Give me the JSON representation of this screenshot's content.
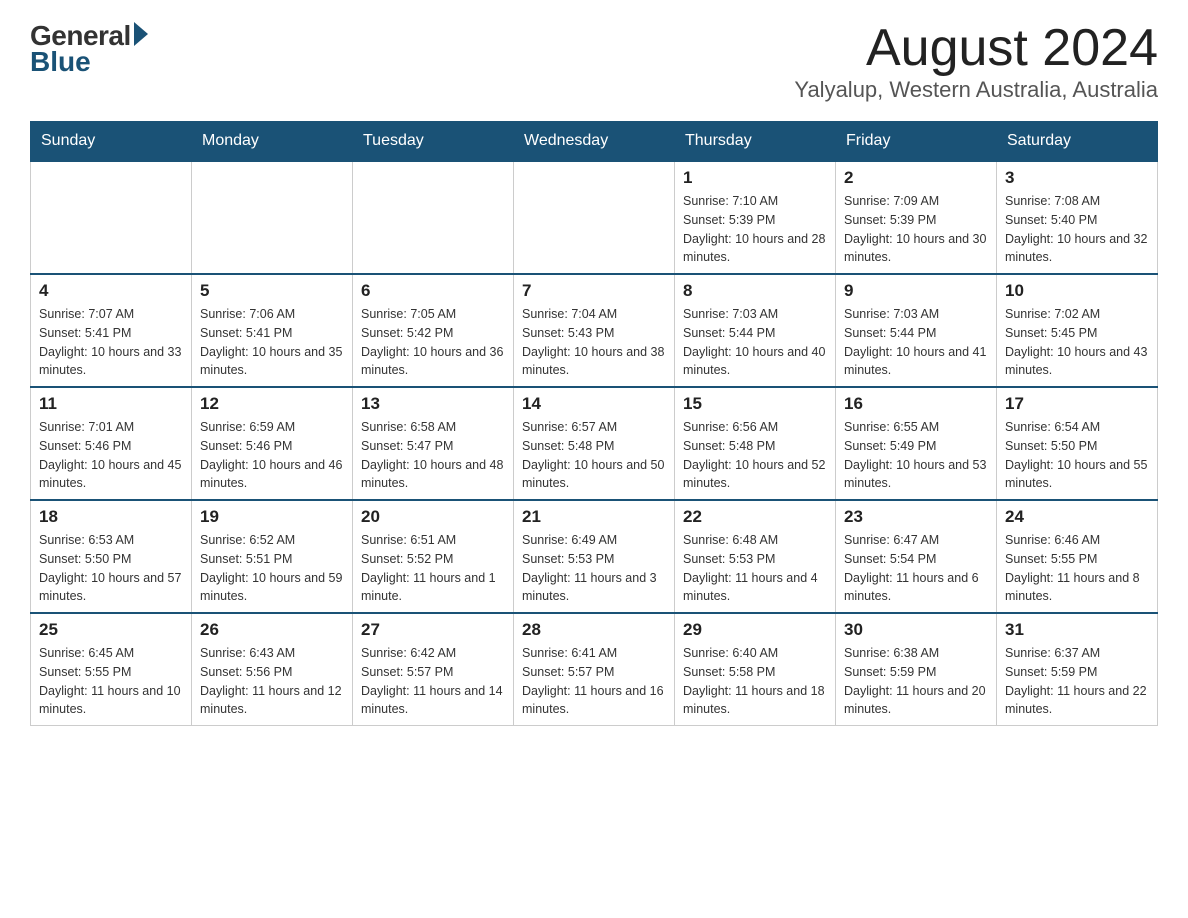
{
  "header": {
    "logo_general": "General",
    "logo_blue": "Blue",
    "month_title": "August 2024",
    "location": "Yalyalup, Western Australia, Australia"
  },
  "calendar": {
    "days_of_week": [
      "Sunday",
      "Monday",
      "Tuesday",
      "Wednesday",
      "Thursday",
      "Friday",
      "Saturday"
    ],
    "weeks": [
      [
        {
          "day": "",
          "info": ""
        },
        {
          "day": "",
          "info": ""
        },
        {
          "day": "",
          "info": ""
        },
        {
          "day": "",
          "info": ""
        },
        {
          "day": "1",
          "info": "Sunrise: 7:10 AM\nSunset: 5:39 PM\nDaylight: 10 hours and 28 minutes."
        },
        {
          "day": "2",
          "info": "Sunrise: 7:09 AM\nSunset: 5:39 PM\nDaylight: 10 hours and 30 minutes."
        },
        {
          "day": "3",
          "info": "Sunrise: 7:08 AM\nSunset: 5:40 PM\nDaylight: 10 hours and 32 minutes."
        }
      ],
      [
        {
          "day": "4",
          "info": "Sunrise: 7:07 AM\nSunset: 5:41 PM\nDaylight: 10 hours and 33 minutes."
        },
        {
          "day": "5",
          "info": "Sunrise: 7:06 AM\nSunset: 5:41 PM\nDaylight: 10 hours and 35 minutes."
        },
        {
          "day": "6",
          "info": "Sunrise: 7:05 AM\nSunset: 5:42 PM\nDaylight: 10 hours and 36 minutes."
        },
        {
          "day": "7",
          "info": "Sunrise: 7:04 AM\nSunset: 5:43 PM\nDaylight: 10 hours and 38 minutes."
        },
        {
          "day": "8",
          "info": "Sunrise: 7:03 AM\nSunset: 5:44 PM\nDaylight: 10 hours and 40 minutes."
        },
        {
          "day": "9",
          "info": "Sunrise: 7:03 AM\nSunset: 5:44 PM\nDaylight: 10 hours and 41 minutes."
        },
        {
          "day": "10",
          "info": "Sunrise: 7:02 AM\nSunset: 5:45 PM\nDaylight: 10 hours and 43 minutes."
        }
      ],
      [
        {
          "day": "11",
          "info": "Sunrise: 7:01 AM\nSunset: 5:46 PM\nDaylight: 10 hours and 45 minutes."
        },
        {
          "day": "12",
          "info": "Sunrise: 6:59 AM\nSunset: 5:46 PM\nDaylight: 10 hours and 46 minutes."
        },
        {
          "day": "13",
          "info": "Sunrise: 6:58 AM\nSunset: 5:47 PM\nDaylight: 10 hours and 48 minutes."
        },
        {
          "day": "14",
          "info": "Sunrise: 6:57 AM\nSunset: 5:48 PM\nDaylight: 10 hours and 50 minutes."
        },
        {
          "day": "15",
          "info": "Sunrise: 6:56 AM\nSunset: 5:48 PM\nDaylight: 10 hours and 52 minutes."
        },
        {
          "day": "16",
          "info": "Sunrise: 6:55 AM\nSunset: 5:49 PM\nDaylight: 10 hours and 53 minutes."
        },
        {
          "day": "17",
          "info": "Sunrise: 6:54 AM\nSunset: 5:50 PM\nDaylight: 10 hours and 55 minutes."
        }
      ],
      [
        {
          "day": "18",
          "info": "Sunrise: 6:53 AM\nSunset: 5:50 PM\nDaylight: 10 hours and 57 minutes."
        },
        {
          "day": "19",
          "info": "Sunrise: 6:52 AM\nSunset: 5:51 PM\nDaylight: 10 hours and 59 minutes."
        },
        {
          "day": "20",
          "info": "Sunrise: 6:51 AM\nSunset: 5:52 PM\nDaylight: 11 hours and 1 minute."
        },
        {
          "day": "21",
          "info": "Sunrise: 6:49 AM\nSunset: 5:53 PM\nDaylight: 11 hours and 3 minutes."
        },
        {
          "day": "22",
          "info": "Sunrise: 6:48 AM\nSunset: 5:53 PM\nDaylight: 11 hours and 4 minutes."
        },
        {
          "day": "23",
          "info": "Sunrise: 6:47 AM\nSunset: 5:54 PM\nDaylight: 11 hours and 6 minutes."
        },
        {
          "day": "24",
          "info": "Sunrise: 6:46 AM\nSunset: 5:55 PM\nDaylight: 11 hours and 8 minutes."
        }
      ],
      [
        {
          "day": "25",
          "info": "Sunrise: 6:45 AM\nSunset: 5:55 PM\nDaylight: 11 hours and 10 minutes."
        },
        {
          "day": "26",
          "info": "Sunrise: 6:43 AM\nSunset: 5:56 PM\nDaylight: 11 hours and 12 minutes."
        },
        {
          "day": "27",
          "info": "Sunrise: 6:42 AM\nSunset: 5:57 PM\nDaylight: 11 hours and 14 minutes."
        },
        {
          "day": "28",
          "info": "Sunrise: 6:41 AM\nSunset: 5:57 PM\nDaylight: 11 hours and 16 minutes."
        },
        {
          "day": "29",
          "info": "Sunrise: 6:40 AM\nSunset: 5:58 PM\nDaylight: 11 hours and 18 minutes."
        },
        {
          "day": "30",
          "info": "Sunrise: 6:38 AM\nSunset: 5:59 PM\nDaylight: 11 hours and 20 minutes."
        },
        {
          "day": "31",
          "info": "Sunrise: 6:37 AM\nSunset: 5:59 PM\nDaylight: 11 hours and 22 minutes."
        }
      ]
    ]
  }
}
